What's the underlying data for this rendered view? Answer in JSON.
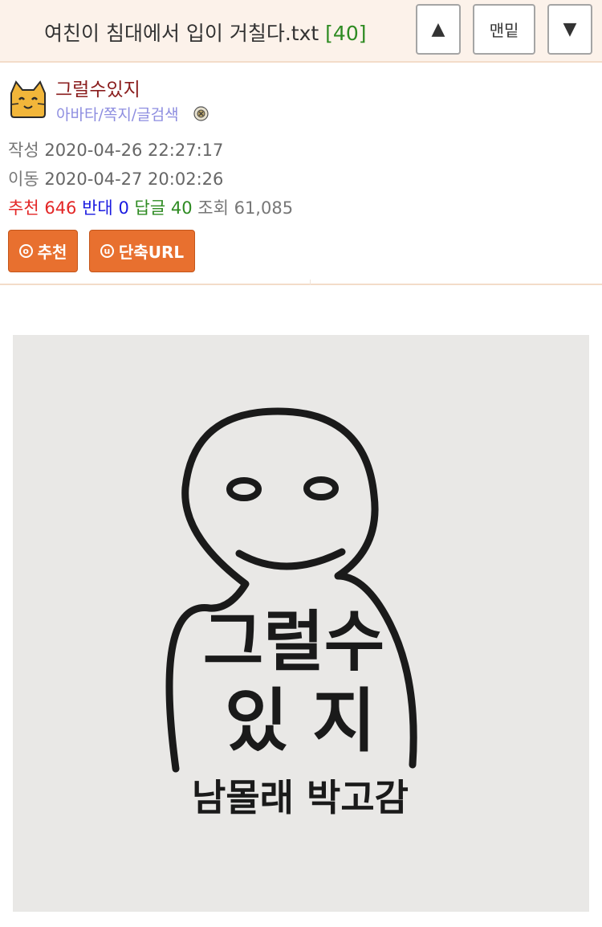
{
  "header": {
    "title": "여친이 침대에서 입이 거칠다.txt",
    "comment_count": "[40]",
    "up_label": "▲",
    "bottom_label": "맨밑",
    "down_label": "▼"
  },
  "post": {
    "author": "그럴수있지",
    "author_links": "아바타/쪽지/글검색",
    "written_label": "작성",
    "written_at": "2020-04-26 22:27:17",
    "moved_label": "이동",
    "moved_at": "2020-04-27 20:02:26",
    "recommend_label": "추천",
    "recommend_count": "646",
    "oppose_label": "반대",
    "oppose_count": "0",
    "reply_label": "답글",
    "reply_count": "40",
    "view_label": "조회",
    "view_count": "61,085",
    "recommend_button": "추천",
    "shorturl_button": "단축URL"
  },
  "image": {
    "text_line1": "그럴수",
    "text_line2": "있 지",
    "text_line3": "남몰래 박고감"
  },
  "colors": {
    "topbar_bg": "#fcf2ea",
    "author": "#8a1d1d",
    "link": "#8e8ee0",
    "recommend": "#e32626",
    "oppose": "#1a1ae0",
    "reply": "#2e8b22",
    "button": "#e8702f"
  },
  "icons": [
    "arrow-up-icon",
    "arrow-down-icon",
    "avatar-cat-icon",
    "badge-icon",
    "recommend-circle-icon",
    "url-circle-icon"
  ]
}
